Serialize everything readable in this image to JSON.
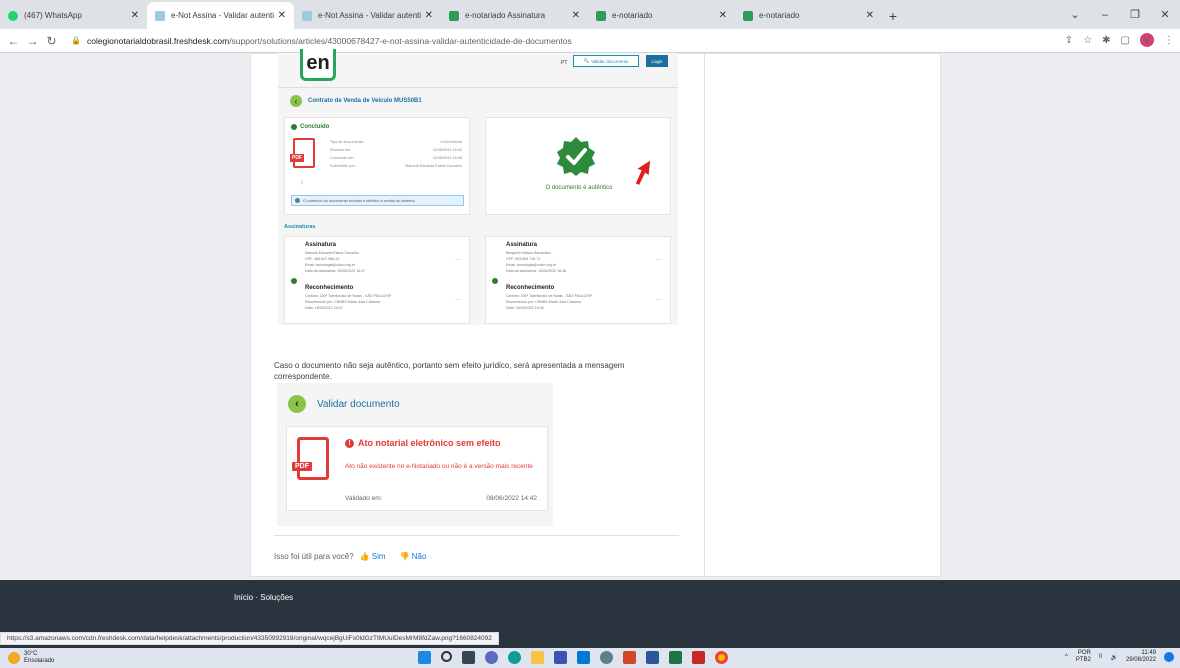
{
  "browser": {
    "tabs": [
      {
        "label": "(467) WhatsApp",
        "color": "#25d366",
        "active": false
      },
      {
        "label": "e-Not Assina - Validar autenticid",
        "color": "#9ecae1",
        "active": true
      },
      {
        "label": "e-Not Assina - Validar autenticid",
        "color": "#9ecae1",
        "active": false
      },
      {
        "label": "e-notariado Assinatura",
        "color": "#2e9d57",
        "active": false
      },
      {
        "label": "e-notariado",
        "color": "#2e9d57",
        "active": false
      },
      {
        "label": "e-notariado",
        "color": "#2e9d57",
        "active": false
      }
    ],
    "url_host": "colegionotarialdobrasil.freshdesk.com",
    "url_path": "/support/solutions/articles/43000678427-e-not-assina-validar-autenticidade-de-documentos",
    "profile_initial": "V"
  },
  "shot1": {
    "lang": "PT",
    "validar_btn": "Validar documento",
    "login_btn": "Login",
    "contrato_title": "Contrato de Venda de Veículo MUS50B1",
    "status": "Concluído",
    "pdf_tag": "PDF",
    "meta": [
      {
        "k": "Tipo de Documento:",
        "v": "e-Not Assina"
      },
      {
        "k": "Enviado em:",
        "v": "15/06/2022 16:42"
      },
      {
        "k": "Concluído em:",
        "v": "15/06/2022 16:48"
      },
      {
        "k": "Submetido por:",
        "v": "Marcela Eduarda Elaine Carvalho"
      }
    ],
    "info_note": "O conteúdo do documento enviado é idêntico à versão do sistema.",
    "autentico": "O documento é autêntico",
    "assinaturas_heading": "Assinaturas",
    "signers": [
      {
        "title": "Assinatura",
        "lines": [
          "Marcela Eduarda Elaine Carvalho",
          "CPF: 466.847.966-24",
          "Email: tecnologia@cnbcf.org.br",
          "Data da assinatura: 15/06/2022 16:47"
        ],
        "rec_title": "Reconhecimento",
        "rec_lines": [
          "Cartório: 200º Tabelionato de Notas - SÃO PAULO/SP",
          "Reconhecido por: CNNBS Maria Julia Cássima",
          "Data: 15/06/2022 16:47"
        ]
      },
      {
        "title": "Assinatura",
        "lines": [
          "Benjamin Nelson Bernardes",
          "CPF: 653.664.716-71",
          "Email: tecnologia@cnbcf.org.br",
          "Data da assinatura: 15/06/2022 16:48"
        ],
        "rec_title": "Reconhecimento",
        "rec_lines": [
          "Cartório: 200º Tabelionato de Notas - SÃO PAULO/SP",
          "Reconhecido por: CNNBS Maria Julia Cássima",
          "Data: 15/06/2022 16:48"
        ]
      }
    ]
  },
  "description": "Caso o documento não seja autêntico, portanto sem efeito jurídico, será apresentada a mensagem correspondente.",
  "shot2": {
    "title": "Validar documento",
    "pdf_tag": "PDF",
    "error_heading": "Ato notarial eletrônico sem efeito",
    "error_message": "Ato não existente no e-Notariado ou não é a versão mais recente",
    "validado_label": "Validado em:",
    "validado_value": "08/06/2022 14:42"
  },
  "feedback": {
    "question": "Isso foi útil para você?",
    "yes": "Sim",
    "no": "Não"
  },
  "footer": {
    "links": "Início  ·  Soluções"
  },
  "status_url": "https://s3.amazonaws.com/cdn.freshdesk.com/data/helpdesk/attachments/production/43350992918/original/wqcejBgUiFs0ldGzTtMUulDesMrM8fdZaw.png?1660824092",
  "taskbar": {
    "weather_temp": "30°C",
    "weather_desc": "Ensolarado",
    "lang": "POR",
    "lang2": "PTB2",
    "time": "11:49",
    "date": "29/08/2022"
  }
}
